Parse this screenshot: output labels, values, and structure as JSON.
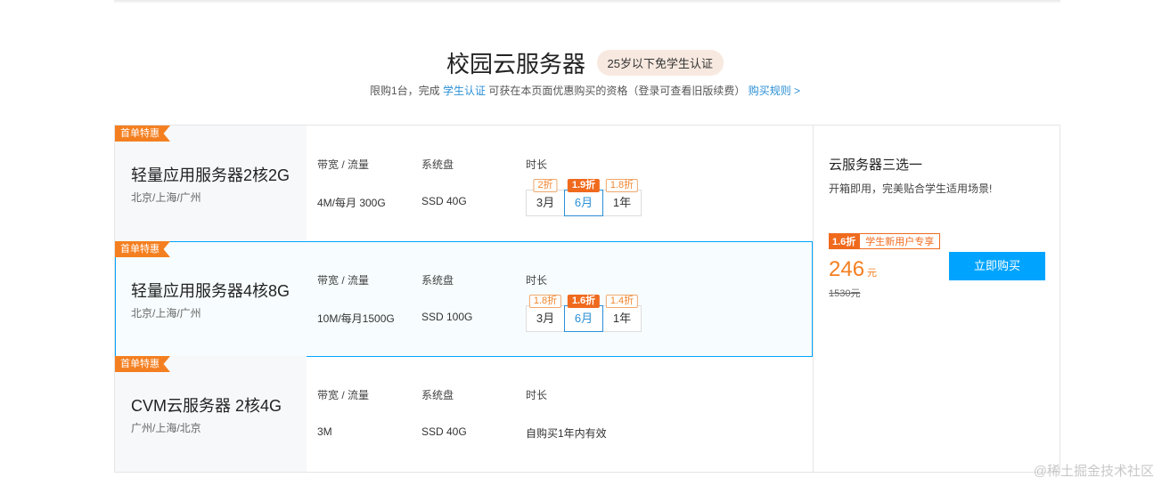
{
  "header": {
    "title": "校园云服务器",
    "badge": "25岁以下免学生认证",
    "sub_prefix": "限购1台，完成",
    "sub_link": "学生认证",
    "sub_middle": "可获在本页面优惠购买的资格（登录可查看旧版续费）",
    "rules_link": "购买规则 >"
  },
  "labels": {
    "bandwidth": "带宽 / 流量",
    "disk": "系统盘",
    "duration": "时长"
  },
  "plans": [
    {
      "tag": "首单特惠",
      "name": "轻量应用服务器2核2G",
      "region": "北京/上海/广州",
      "bandwidth": "4M/每月 300G",
      "disk": "SSD 40G",
      "durations": [
        {
          "label": "3月",
          "discount": "2折"
        },
        {
          "label": "6月",
          "discount": "1.9折"
        },
        {
          "label": "1年",
          "discount": "1.8折"
        }
      ]
    },
    {
      "tag": "首单特惠",
      "name": "轻量应用服务器4核8G",
      "region": "北京/上海/广州",
      "bandwidth": "10M/每月1500G",
      "disk": "SSD 100G",
      "durations": [
        {
          "label": "3月",
          "discount": "1.8折"
        },
        {
          "label": "6月",
          "discount": "1.6折"
        },
        {
          "label": "1年",
          "discount": "1.4折"
        }
      ]
    },
    {
      "tag": "首单特惠",
      "name": "CVM云服务器 2核4G",
      "region": "广州/上海/北京",
      "bandwidth": "3M",
      "disk": "SSD 40G",
      "validity": "自购买1年内有效"
    }
  ],
  "side": {
    "title": "云服务器三选一",
    "desc": "开箱即用，完美贴合学生适用场景!",
    "promo_discount": "1.6折",
    "promo_text": "学生新用户专享",
    "price": "246",
    "price_unit": "元",
    "original_price": "1530元",
    "buy_label": "立即购买"
  },
  "watermark": "@稀土掘金技术社区",
  "colors": {
    "accent": "#00a4ff",
    "orange": "#f47f20",
    "link": "#2b8fd6"
  }
}
